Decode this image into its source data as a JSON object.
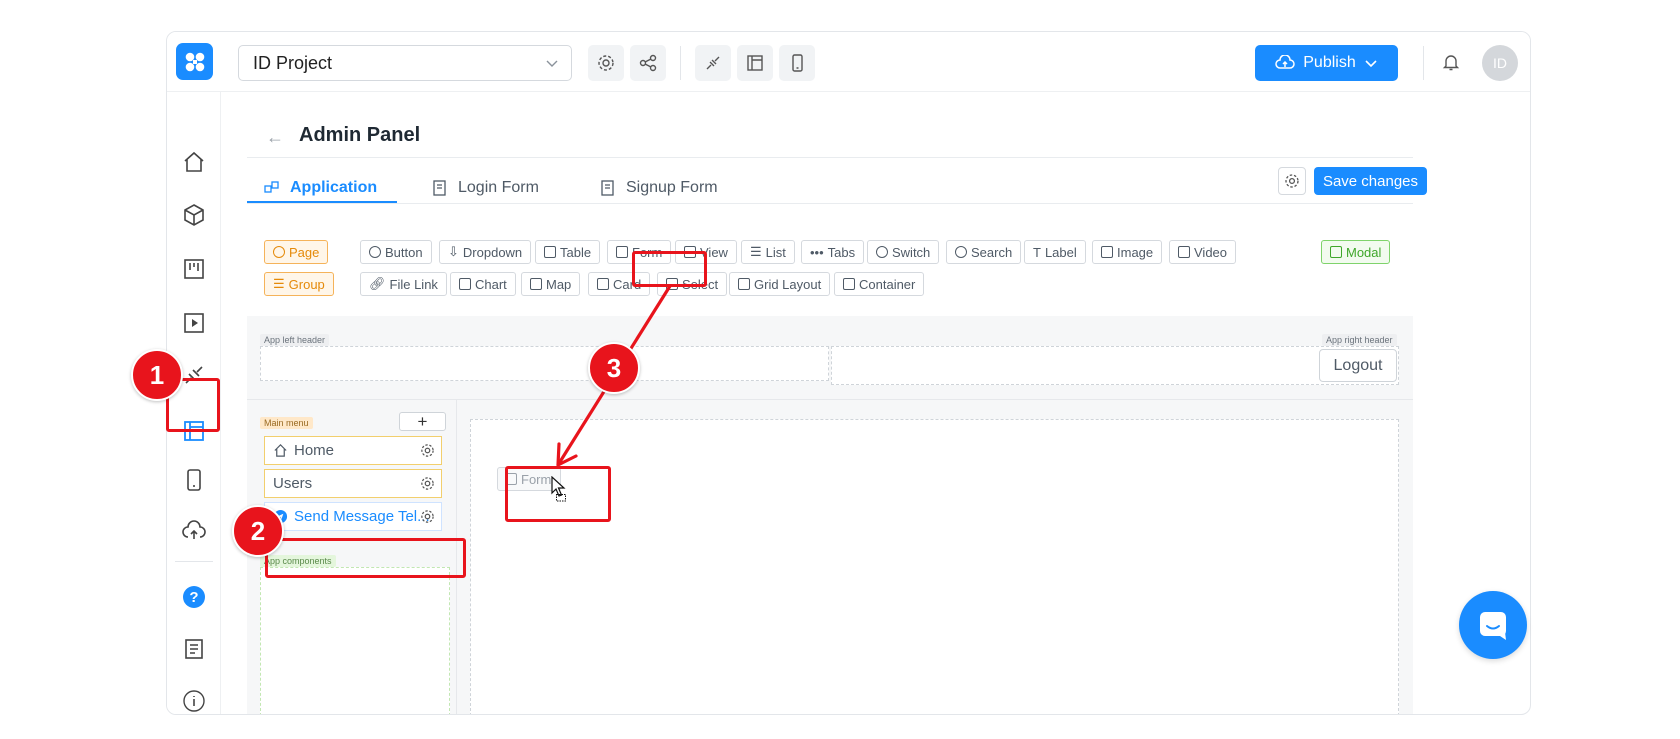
{
  "topbar": {
    "project_name": "ID Project",
    "publish_label": "Publish",
    "avatar_initials": "ID"
  },
  "page": {
    "title": "Admin Panel"
  },
  "tabs": [
    {
      "label": "Application",
      "active": true
    },
    {
      "label": "Login Form",
      "active": false
    },
    {
      "label": "Signup Form",
      "active": false
    }
  ],
  "actions": {
    "save_label": "Save changes"
  },
  "components": {
    "row1": [
      "Page",
      "Button",
      "Dropdown",
      "Table",
      "Form",
      "View",
      "List",
      "Tabs",
      "Switch",
      "Search",
      "Label",
      "Image",
      "Video",
      "Modal"
    ],
    "row2": [
      "Group",
      "File Link",
      "Chart",
      "Map",
      "Card",
      "Select",
      "Grid Layout",
      "Container"
    ]
  },
  "canvas": {
    "left_header_tag": "App left header",
    "right_header_tag": "App right header",
    "logout_label": "Logout",
    "main_menu_tag": "Main menu",
    "add_label": "+",
    "menu_items": [
      "Home",
      "Users",
      "Send Message Tel..."
    ],
    "app_components_tag": "App components",
    "dragged_component": "Form"
  },
  "annotations": {
    "markers": [
      "1",
      "2",
      "3"
    ]
  },
  "colors": {
    "accent": "#1a8cff",
    "highlight": "#e8141c",
    "group_orange": "#e58a0a",
    "modal_green": "#3fa72a"
  }
}
